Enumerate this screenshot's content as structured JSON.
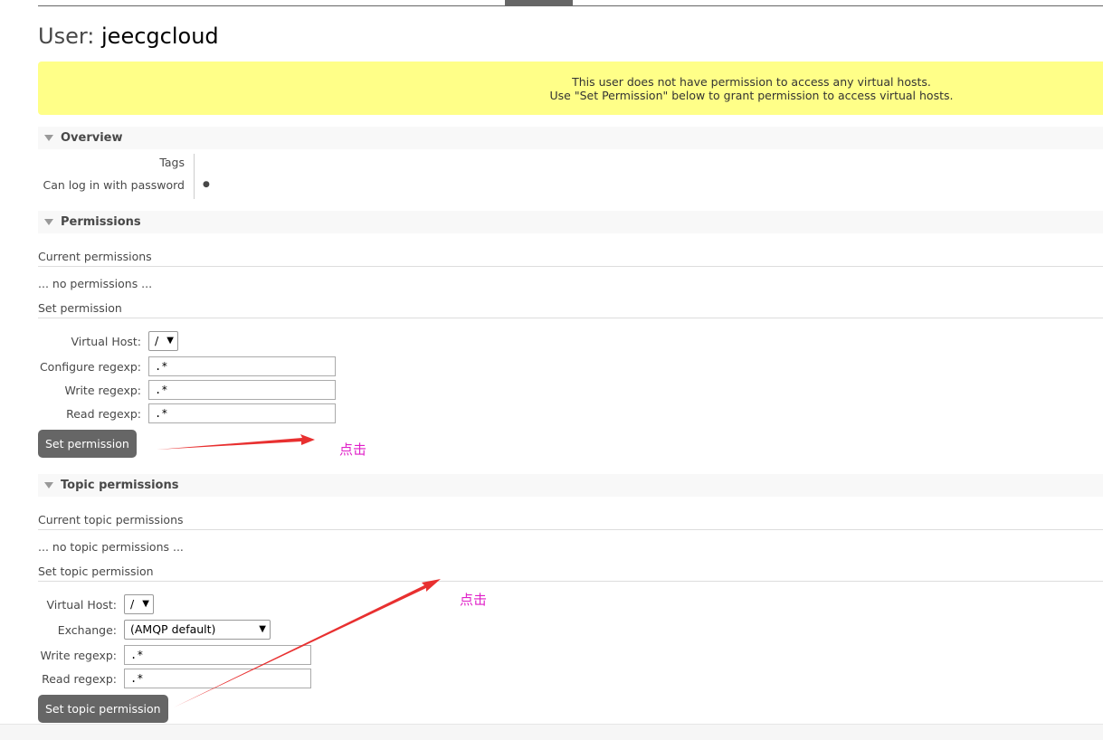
{
  "header": {
    "title_prefix": "User:",
    "username": "jeecgcloud"
  },
  "warning": {
    "line1": "This user does not have permission to access any virtual hosts.",
    "line2": "Use \"Set Permission\" below to grant permission to access virtual hosts."
  },
  "overview": {
    "title": "Overview",
    "tags_label": "Tags",
    "tags_value": "",
    "login_label": "Can log in with password",
    "login_value": "●"
  },
  "permissions": {
    "title": "Permissions",
    "current_label": "Current permissions",
    "empty_text": "... no permissions ...",
    "set_label": "Set permission",
    "vhost_label": "Virtual Host:",
    "vhost_value": "/",
    "configure_label": "Configure regexp:",
    "configure_value": ".*",
    "write_label": "Write regexp:",
    "write_value": ".*",
    "read_label": "Read regexp:",
    "read_value": ".*",
    "button_label": "Set permission",
    "annotation": "点击"
  },
  "topic_permissions": {
    "title": "Topic permissions",
    "current_label": "Current topic permissions",
    "empty_text": "... no topic permissions ...",
    "set_label": "Set topic permission",
    "vhost_label": "Virtual Host:",
    "vhost_value": "/",
    "exchange_label": "Exchange:",
    "exchange_value": "(AMQP default)",
    "write_label": "Write regexp:",
    "write_value": ".*",
    "read_label": "Read regexp:",
    "read_value": ".*",
    "button_label": "Set topic permission",
    "annotation": "点击"
  },
  "icons": {
    "section_toggle": "triangle-down-icon",
    "dropdown": "chevron-down-icon",
    "annotation_arrow": "red-arrow-icon"
  },
  "colors": {
    "warning_bg": "#ffff88",
    "button_bg": "#666666",
    "annotation_text": "#e020c8",
    "annotation_arrow": "#e83030"
  }
}
